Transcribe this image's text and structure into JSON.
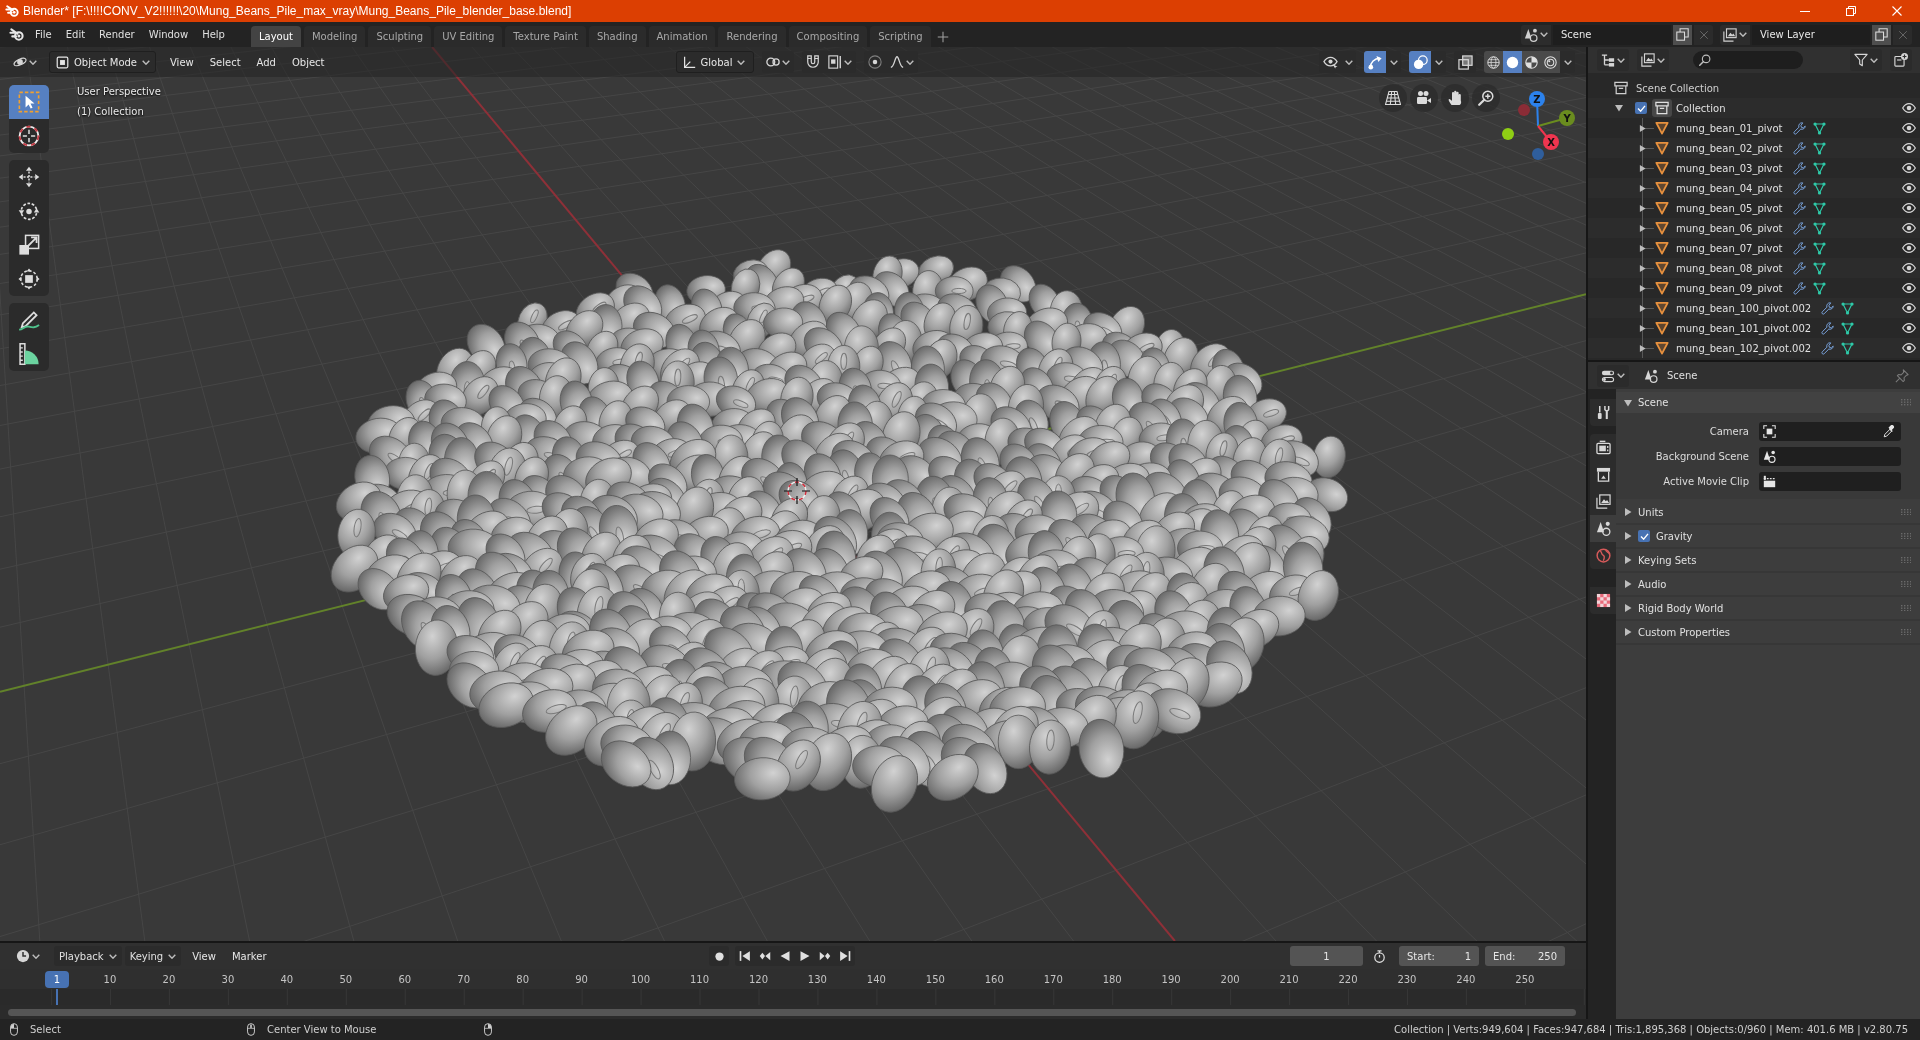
{
  "window": {
    "title": "Blender* [F:\\!!!!CONV_V2!!!!!!\\20\\Mung_Beans_Pile_max_vray\\Mung_Beans_Pile_blender_base.blend]"
  },
  "menu": [
    "File",
    "Edit",
    "Render",
    "Window",
    "Help"
  ],
  "workspace_tabs": [
    {
      "label": "Layout",
      "selected": true
    },
    {
      "label": "Modeling",
      "selected": false
    },
    {
      "label": "Sculpting",
      "selected": false
    },
    {
      "label": "UV Editing",
      "selected": false
    },
    {
      "label": "Texture Paint",
      "selected": false
    },
    {
      "label": "Shading",
      "selected": false
    },
    {
      "label": "Animation",
      "selected": false
    },
    {
      "label": "Rendering",
      "selected": false
    },
    {
      "label": "Compositing",
      "selected": false
    },
    {
      "label": "Scripting",
      "selected": false
    }
  ],
  "scene_selector": {
    "value": "Scene"
  },
  "view_layer_selector": {
    "value": "View Layer"
  },
  "viewport": {
    "mode": "Object Mode",
    "menus": [
      "View",
      "Select",
      "Add",
      "Object"
    ],
    "orientation": "Global",
    "snapping": {
      "on": false
    },
    "proportional_editing": {
      "on": false
    },
    "toggles": [
      {
        "kind": "visibility",
        "on": false
      },
      {
        "kind": "gizmos",
        "on": true
      },
      {
        "kind": "overlays",
        "on": true
      },
      {
        "kind": "xray",
        "on": false
      }
    ],
    "shading": [
      {
        "kind": "wireframe",
        "selected": false
      },
      {
        "kind": "solid",
        "selected": true
      },
      {
        "kind": "material",
        "selected": false
      },
      {
        "kind": "rendered",
        "selected": false
      }
    ],
    "info": [
      "User Perspective",
      "(1) Collection"
    ],
    "tool_groups": [
      [
        {
          "kind": "select-box",
          "selected": true
        },
        {
          "kind": "cursor",
          "selected": false
        }
      ],
      [
        {
          "kind": "move",
          "selected": false
        },
        {
          "kind": "rotate",
          "selected": false
        },
        {
          "kind": "scale",
          "selected": false
        },
        {
          "kind": "transform",
          "selected": false
        }
      ],
      [
        {
          "kind": "annotate",
          "selected": false
        },
        {
          "kind": "measure",
          "selected": false
        }
      ]
    ],
    "gizmo_axes": [
      {
        "label": "Z",
        "color": "#2c82ec"
      },
      {
        "label": "Y",
        "color": "#6a8c1f"
      },
      {
        "label": "X",
        "color": "#f0354f"
      }
    ]
  },
  "outliner": {
    "root": "Scene Collection",
    "collections": [
      {
        "name": "Collection",
        "expanded": true,
        "checked": true,
        "visible": true,
        "children": [
          {
            "name": "mung_bean_01_pivot",
            "expanded": false,
            "visible": true
          },
          {
            "name": "mung_bean_02_pivot",
            "expanded": false,
            "visible": true
          },
          {
            "name": "mung_bean_03_pivot",
            "expanded": false,
            "visible": true
          },
          {
            "name": "mung_bean_04_pivot",
            "expanded": false,
            "visible": true
          },
          {
            "name": "mung_bean_05_pivot",
            "expanded": false,
            "visible": true
          },
          {
            "name": "mung_bean_06_pivot",
            "expanded": false,
            "visible": true
          },
          {
            "name": "mung_bean_07_pivot",
            "expanded": false,
            "visible": true
          },
          {
            "name": "mung_bean_08_pivot",
            "expanded": false,
            "visible": true
          },
          {
            "name": "mung_bean_09_pivot",
            "expanded": false,
            "visible": true
          },
          {
            "name": "mung_bean_100_pivot.002",
            "expanded": false,
            "visible": true
          },
          {
            "name": "mung_bean_101_pivot.002",
            "expanded": false,
            "visible": true
          },
          {
            "name": "mung_bean_102_pivot.002",
            "expanded": false,
            "visible": true
          }
        ]
      }
    ]
  },
  "properties": {
    "context": "Scene",
    "tab_groups": [
      [
        {
          "kind": "tool",
          "selected": false
        }
      ],
      [
        {
          "kind": "render",
          "selected": false
        },
        {
          "kind": "output",
          "selected": false
        },
        {
          "kind": "view-layer",
          "selected": false
        },
        {
          "kind": "scene",
          "selected": true
        },
        {
          "kind": "world",
          "selected": false
        }
      ],
      [
        {
          "kind": "texture",
          "selected": false
        }
      ]
    ],
    "panels": [
      {
        "title": "Scene",
        "kind": "plain",
        "expanded": true,
        "fields": [
          {
            "label": "Camera",
            "kind": "camera"
          },
          {
            "label": "Background Scene",
            "kind": "scene"
          },
          {
            "label": "Active Movie Clip",
            "kind": "clip"
          }
        ]
      },
      {
        "title": "Units",
        "kind": "plain",
        "expanded": false
      },
      {
        "title": "Gravity",
        "kind": "checkbox",
        "expanded": false,
        "checked": true
      },
      {
        "title": "Keying Sets",
        "kind": "plain",
        "expanded": false
      },
      {
        "title": "Audio",
        "kind": "plain",
        "expanded": false
      },
      {
        "title": "Rigid Body World",
        "kind": "plain",
        "expanded": false
      },
      {
        "title": "Custom Properties",
        "kind": "plain",
        "expanded": false
      }
    ]
  },
  "timeline": {
    "menus": [
      {
        "label": "Playback",
        "kind": "dropdown"
      },
      {
        "label": "Keying",
        "kind": "dropdown"
      },
      {
        "label": "View",
        "kind": "menu"
      },
      {
        "label": "Marker",
        "kind": "menu"
      }
    ],
    "auto_keying": {
      "on": false
    },
    "frame": "1",
    "start_label": "Start:",
    "start": "1",
    "end_label": "End:",
    "end": "250",
    "playhead": "1",
    "ruler": [
      "10",
      "20",
      "30",
      "40",
      "50",
      "60",
      "70",
      "80",
      "90",
      "100",
      "110",
      "120",
      "130",
      "140",
      "150",
      "160",
      "170",
      "180",
      "190",
      "200",
      "210",
      "220",
      "230",
      "240",
      "250"
    ]
  },
  "status_bar": {
    "hints": [
      {
        "kind": "left-click",
        "label": "Select"
      },
      {
        "kind": "middle-click",
        "label": "Center View to Mouse"
      },
      {
        "kind": "right-click"
      }
    ],
    "stats": "Collection | Verts:949,604 | Faces:947,684 | Tris:1,895,368 | Objects:0/960 | Mem: 401.6 MB | v2.80.75"
  }
}
